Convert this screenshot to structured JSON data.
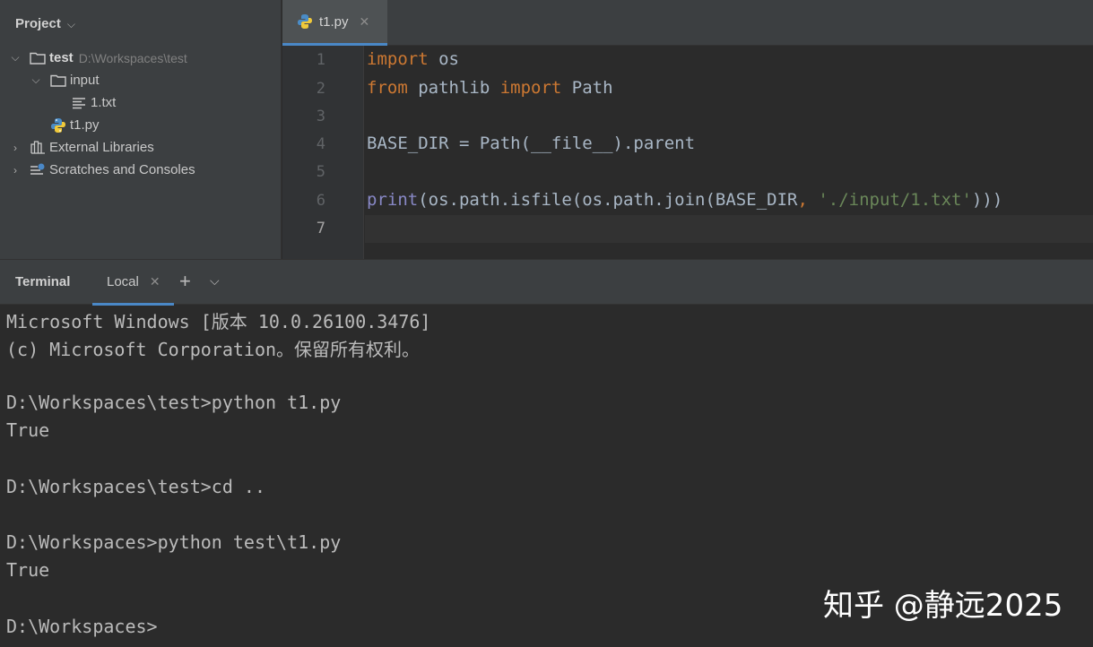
{
  "project_panel": {
    "title": "Project",
    "tree": {
      "root_name": "test",
      "root_path": "D:\\Workspaces\\test",
      "input_folder": "input",
      "input_file": "1.txt",
      "script_file": "t1.py",
      "external_libraries": "External Libraries",
      "scratches": "Scratches and Consoles"
    }
  },
  "editor": {
    "tab_label": "t1.py",
    "line_numbers": [
      "1",
      "2",
      "3",
      "4",
      "5",
      "6",
      "7"
    ],
    "current_line": "7",
    "code": {
      "l1_kw": "import",
      "l1_rest": " os",
      "l2_kw1": "from",
      "l2_mid": " pathlib ",
      "l2_kw2": "import",
      "l2_rest": " Path",
      "l4": "BASE_DIR = Path(__file__).parent",
      "l6_builtin": "print",
      "l6_a": "(os.path.isfile(os.path.join(BASE_DIR",
      "l6_comma": ", ",
      "l6_str": "'./input/1.txt'",
      "l6_end": ")))"
    }
  },
  "terminal": {
    "title": "Terminal",
    "tab_label": "Local",
    "lines": [
      "Microsoft Windows [版本 10.0.26100.3476]",
      "(c) Microsoft Corporation。保留所有权利。",
      "",
      "D:\\Workspaces\\test>python t1.py",
      "True",
      "",
      "D:\\Workspaces\\test>cd ..",
      "",
      "D:\\Workspaces>python test\\t1.py",
      "True",
      "",
      "D:\\Workspaces>"
    ]
  },
  "watermark": "知乎 @静远2025",
  "colors": {
    "panel_bg": "#3c3f41",
    "editor_bg": "#2b2b2b",
    "accent": "#4a88c7",
    "keyword": "#cc7832",
    "builtin": "#8888c6",
    "string": "#6a8759",
    "text": "#a9b7c6"
  },
  "icons": {
    "folder": "folder-icon",
    "text_file": "text-file-icon",
    "python_file": "python-file-icon",
    "library": "library-icon",
    "scratches": "scratches-icon"
  }
}
